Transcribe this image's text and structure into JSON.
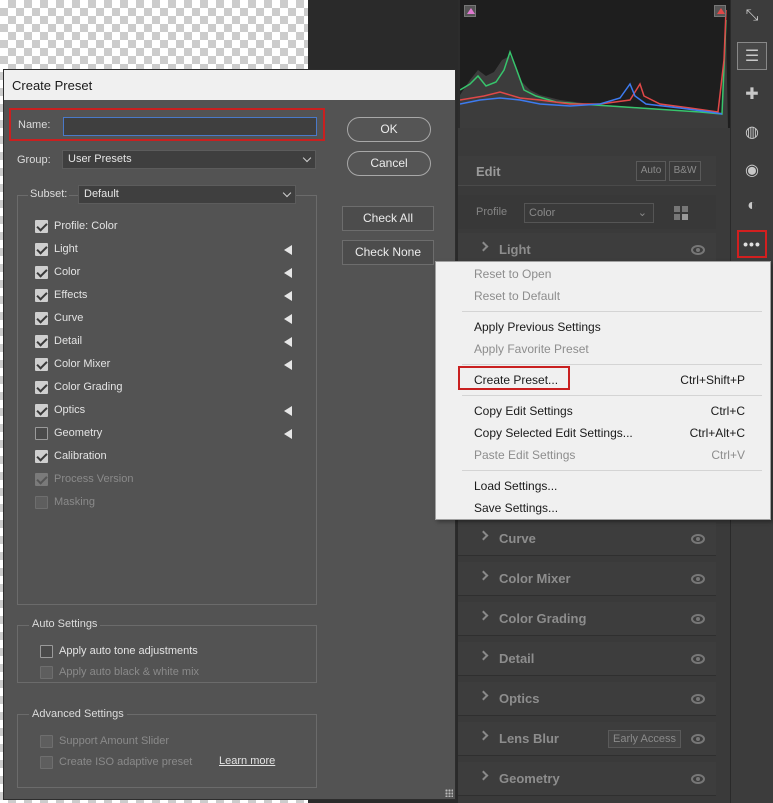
{
  "dialog": {
    "title": "Create Preset",
    "name_label": "Name:",
    "name_value": "",
    "group_label": "Group:",
    "group_value": "User Presets",
    "subset_label": "Subset:",
    "subset_value": "Default",
    "ok_label": "OK",
    "cancel_label": "Cancel",
    "check_all_label": "Check All",
    "check_none_label": "Check None",
    "items": [
      {
        "label": "Profile: Color",
        "checked": true,
        "disabled": false,
        "expandable": false
      },
      {
        "label": "Light",
        "checked": true,
        "disabled": false,
        "expandable": true
      },
      {
        "label": "Color",
        "checked": true,
        "disabled": false,
        "expandable": true
      },
      {
        "label": "Effects",
        "checked": true,
        "disabled": false,
        "expandable": true
      },
      {
        "label": "Curve",
        "checked": true,
        "disabled": false,
        "expandable": true
      },
      {
        "label": "Detail",
        "checked": true,
        "disabled": false,
        "expandable": true
      },
      {
        "label": "Color Mixer",
        "checked": true,
        "disabled": false,
        "expandable": true
      },
      {
        "label": "Color Grading",
        "checked": true,
        "disabled": false,
        "expandable": false
      },
      {
        "label": "Optics",
        "checked": true,
        "disabled": false,
        "expandable": true
      },
      {
        "label": "Geometry",
        "checked": false,
        "disabled": false,
        "expandable": true
      },
      {
        "label": "Calibration",
        "checked": true,
        "disabled": false,
        "expandable": false
      },
      {
        "label": "Process Version",
        "checked": true,
        "disabled": true,
        "expandable": false
      },
      {
        "label": "Masking",
        "checked": false,
        "disabled": true,
        "expandable": false
      }
    ],
    "auto_settings": {
      "title": "Auto Settings",
      "tone": "Apply auto tone adjustments",
      "bw": "Apply auto black & white mix"
    },
    "advanced_settings": {
      "title": "Advanced Settings",
      "amount": "Support Amount Slider",
      "iso": "Create ISO adaptive preset",
      "learn_more": "Learn more"
    }
  },
  "menu": {
    "reset_open": "Reset to Open",
    "reset_default": "Reset to Default",
    "apply_previous": "Apply Previous Settings",
    "apply_favorite": "Apply Favorite Preset",
    "create_preset": "Create Preset...",
    "create_preset_shortcut": "Ctrl+Shift+P",
    "copy_edit": "Copy Edit Settings",
    "copy_edit_shortcut": "Ctrl+C",
    "copy_selected": "Copy Selected Edit Settings...",
    "copy_selected_shortcut": "Ctrl+Alt+C",
    "paste_edit": "Paste Edit Settings",
    "paste_edit_shortcut": "Ctrl+V",
    "load": "Load Settings...",
    "save": "Save Settings..."
  },
  "edit_panel": {
    "title": "Edit",
    "auto_label": "Auto",
    "bw_label": "B&W",
    "profile_label": "Profile",
    "profile_value": "Color",
    "sections": [
      "Light",
      "Curve",
      "Color Mixer",
      "Color Grading",
      "Detail",
      "Optics",
      "Lens Blur",
      "Geometry"
    ],
    "early_access": "Early Access"
  },
  "colors": {
    "highlight_red": "#c92020",
    "dialog_bg": "#535353",
    "menu_bg": "#f0f0f0"
  }
}
